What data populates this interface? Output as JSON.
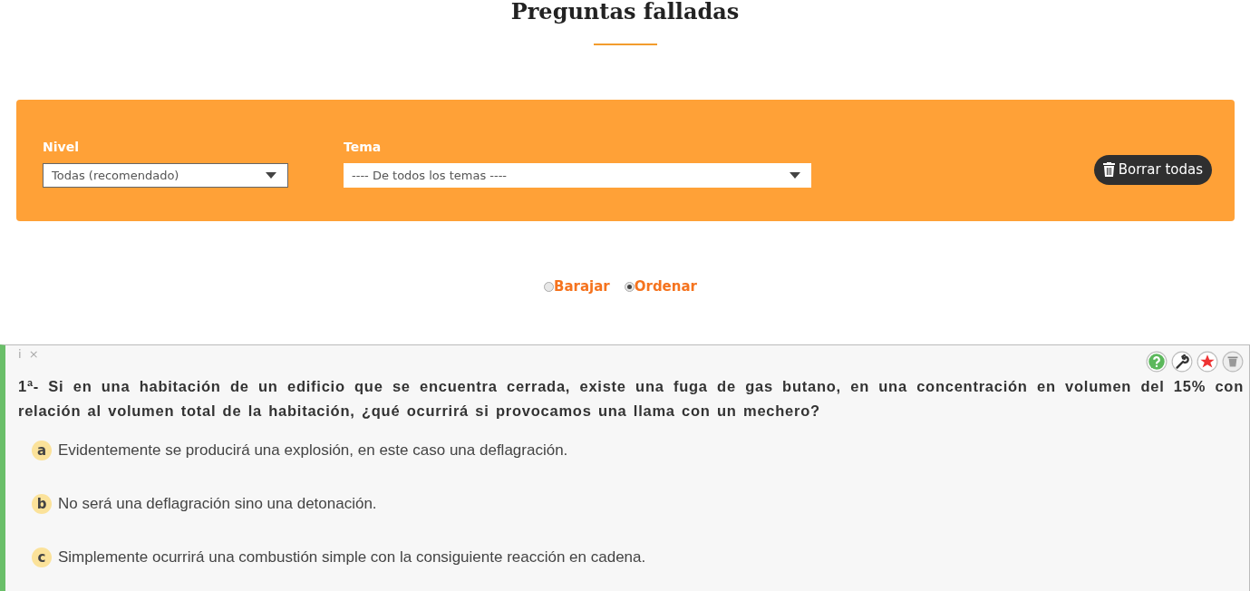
{
  "title": "Preguntas falladas",
  "filters": {
    "nivel": {
      "label": "Nivel",
      "value": "Todas (recomendado)"
    },
    "tema": {
      "label": "Tema",
      "value": "---- De todos los temas ----"
    },
    "delete_all": "Borrar todas"
  },
  "order_options": [
    {
      "label": "Barajar",
      "selected": false
    },
    {
      "label": "Ordenar",
      "selected": true
    }
  ],
  "question": {
    "info": "i",
    "close": "×",
    "text": "1ª- Si en una habitación de un edificio que se encuentra cerrada, existe una fuga de gas butano, en una concentración en volumen del 15% con relación al volumen total de la habitación, ¿qué ocurrirá si provocamos una llama con un mechero?",
    "answers": [
      {
        "letter": "a",
        "text": "Evidentemente se producirá una explosión, en este caso una deflagración."
      },
      {
        "letter": "b",
        "text": "No será una deflagración sino una detonación."
      },
      {
        "letter": "c",
        "text": "Simplemente ocurrirá una combustión simple con la consiguiente reacción en cadena."
      }
    ]
  }
}
